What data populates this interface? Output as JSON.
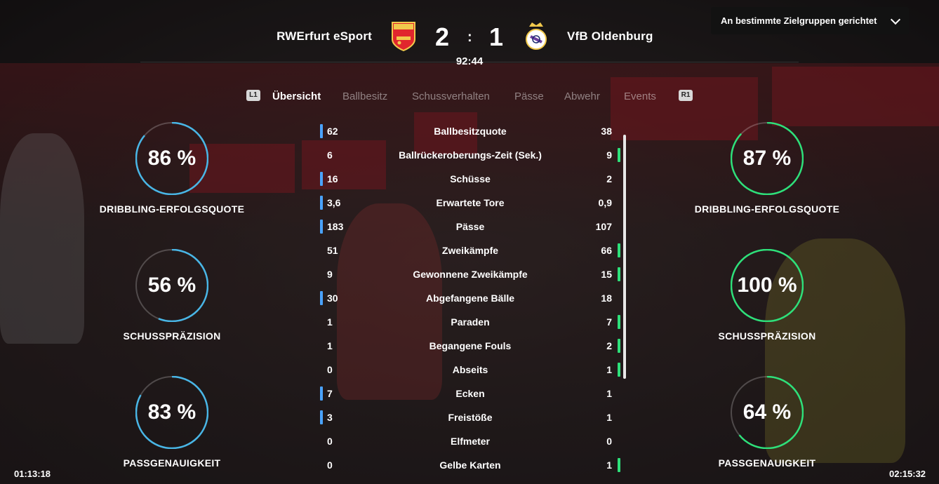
{
  "header": {
    "home_team": "RWErfurt eSport",
    "away_team": "VfB Oldenburg",
    "home_score": "2",
    "away_score": "1",
    "separator": ":",
    "clock": "92:44",
    "home_crest_icon": "arsenal-crest-icon",
    "away_crest_icon": "real-madrid-crest-icon"
  },
  "dropdown": {
    "label": "An bestimmte Zielgruppen gerichtet",
    "icon": "chevron-down-icon"
  },
  "tabs": {
    "left_button": "L1",
    "right_button": "R1",
    "items": [
      "Übersicht",
      "Ballbesitz",
      "Schussverhalten",
      "Pässe",
      "Abwehr",
      "Events"
    ],
    "active": "Übersicht"
  },
  "left_rings": [
    {
      "value": "86 %",
      "label": "DRIBBLING-ERFOLGSQUOTE",
      "fraction": 0.86
    },
    {
      "value": "56 %",
      "label": "SCHUSSPRÄZISION",
      "fraction": 0.56
    },
    {
      "value": "83 %",
      "label": "PASSGENAUIGKEIT",
      "fraction": 0.83
    }
  ],
  "right_rings": [
    {
      "value": "87 %",
      "label": "DRIBBLING-ERFOLGSQUOTE",
      "fraction": 0.87
    },
    {
      "value": "100 %",
      "label": "SCHUSSPRÄZISION",
      "fraction": 1.0
    },
    {
      "value": "64 %",
      "label": "PASSGENAUIGKEIT",
      "fraction": 0.64
    }
  ],
  "stats": [
    {
      "name": "Ballbesitzquote",
      "home": "62",
      "away": "38",
      "leader": "home"
    },
    {
      "name": "Ballrückeroberungs-Zeit (Sek.)",
      "home": "6",
      "away": "9",
      "leader": "away"
    },
    {
      "name": "Schüsse",
      "home": "16",
      "away": "2",
      "leader": "home"
    },
    {
      "name": "Erwartete Tore",
      "home": "3,6",
      "away": "0,9",
      "leader": "home"
    },
    {
      "name": "Pässe",
      "home": "183",
      "away": "107",
      "leader": "home"
    },
    {
      "name": "Zweikämpfe",
      "home": "51",
      "away": "66",
      "leader": "away"
    },
    {
      "name": "Gewonnene Zweikämpfe",
      "home": "9",
      "away": "15",
      "leader": "away"
    },
    {
      "name": "Abgefangene Bälle",
      "home": "30",
      "away": "18",
      "leader": "home"
    },
    {
      "name": "Paraden",
      "home": "1",
      "away": "7",
      "leader": "away"
    },
    {
      "name": "Begangene Fouls",
      "home": "1",
      "away": "2",
      "leader": "away"
    },
    {
      "name": "Abseits",
      "home": "0",
      "away": "1",
      "leader": "away"
    },
    {
      "name": "Ecken",
      "home": "7",
      "away": "1",
      "leader": "home"
    },
    {
      "name": "Freistöße",
      "home": "3",
      "away": "1",
      "leader": "home"
    },
    {
      "name": "Elfmeter",
      "home": "0",
      "away": "0",
      "leader": "none"
    },
    {
      "name": "Gelbe Karten",
      "home": "0",
      "away": "1",
      "leader": "away"
    }
  ],
  "playback": {
    "elapsed": "01:13:18",
    "total": "02:15:32"
  },
  "colors": {
    "home_accent": "#4aa3ff",
    "away_accent": "#2ee07a",
    "left_ring": "#49b6e6",
    "right_ring": "#2ee07a"
  }
}
